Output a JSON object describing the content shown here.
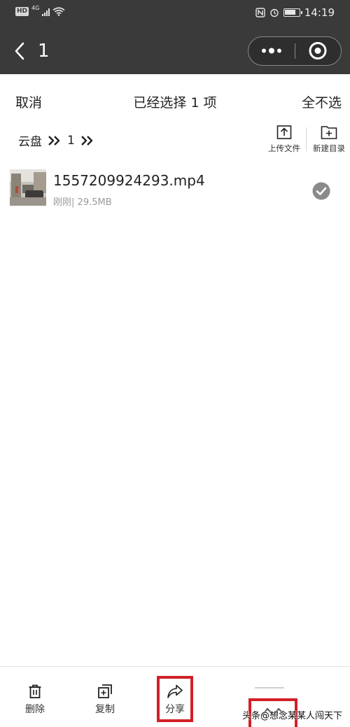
{
  "status_bar": {
    "hd_badge": "HD",
    "network": "4G",
    "time": "14:19",
    "nfc_label": "N"
  },
  "nav": {
    "title": "1"
  },
  "action_bar": {
    "cancel": "取消",
    "selected_text": "已经选择 1 项",
    "deselect_all": "全不选"
  },
  "breadcrumb": {
    "items": [
      "云盘",
      "1"
    ]
  },
  "tools": {
    "upload": "上传文件",
    "new_folder": "新建目录"
  },
  "file": {
    "name": "1557209924293.mp4",
    "time": "刚刚",
    "size": "29.5MB",
    "separator": "|"
  },
  "bottom_toolbar": {
    "delete": "删除",
    "copy": "复制",
    "share": "分享"
  },
  "watermark": "头条@想念某某人闯天下",
  "colors": {
    "header_bg": "#3a3a3a",
    "highlight_red": "#d21f27",
    "check_gray": "#8a8a8a"
  },
  "icons": [
    "back-arrow-icon",
    "more-dots-icon",
    "close-target-icon",
    "chevron-double-right-icon",
    "upload-icon",
    "new-folder-icon",
    "check-circle-icon",
    "trash-icon",
    "copy-icon",
    "share-icon"
  ]
}
